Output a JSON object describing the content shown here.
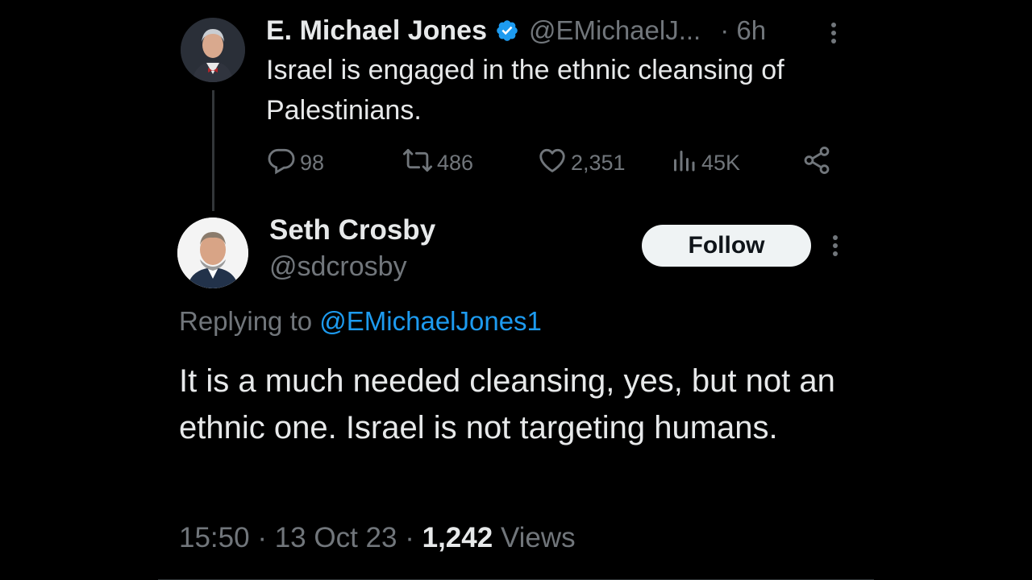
{
  "parent": {
    "name": "E. Michael Jones",
    "handle": "@EMichaelJ...",
    "time": "· 6h",
    "text": "Israel is engaged in the ethnic cleansing of Palestinians.",
    "replies": "98",
    "reposts": "486",
    "likes": "2,351",
    "views": "45K"
  },
  "reply": {
    "name": "Seth Crosby",
    "handle": "@sdcrosby",
    "follow_label": "Follow",
    "replying_prefix": "Replying to",
    "replying_to": "@EMichaelJones1",
    "text": "It is a much needed cleansing, yes, but not an ethnic one. Israel is not targeting humans.",
    "time": "15:50",
    "sep1": "·",
    "date": "13 Oct 23",
    "sep2": "·",
    "views_count": "1,242",
    "views_label": "Views"
  },
  "icons": {
    "verified": "verified-badge-icon",
    "more": "more-dots-icon",
    "reply": "reply-icon",
    "repost": "repost-icon",
    "like": "heart-icon",
    "views": "analytics-icon",
    "share": "share-icon"
  },
  "colors": {
    "background": "#000000",
    "text": "#e7e9ea",
    "muted": "#71767b",
    "link": "#1d9bf0",
    "button_bg": "#eff3f4"
  }
}
